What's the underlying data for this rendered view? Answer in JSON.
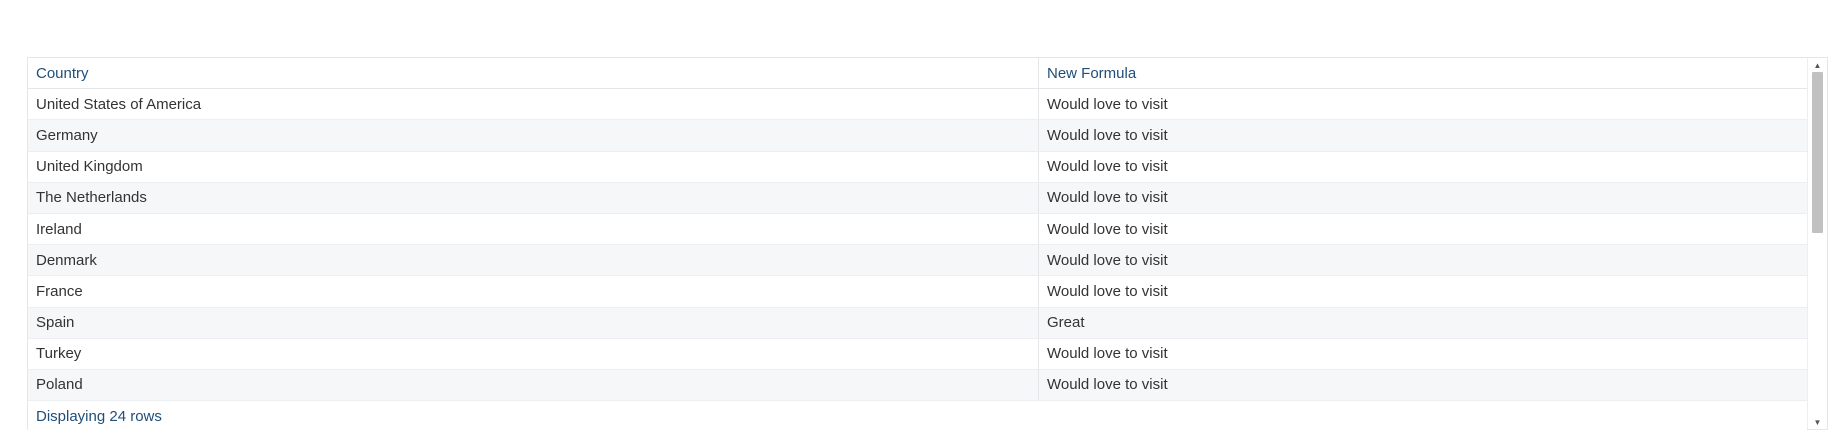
{
  "table": {
    "columns": [
      "Country",
      "New Formula"
    ],
    "rows": [
      [
        "United States of America",
        "Would love to visit"
      ],
      [
        "Germany",
        "Would love to visit"
      ],
      [
        "United Kingdom",
        "Would love to visit"
      ],
      [
        "The Netherlands",
        "Would love to visit"
      ],
      [
        "Ireland",
        "Would love to visit"
      ],
      [
        "Denmark",
        "Would love to visit"
      ],
      [
        "France",
        "Would love to visit"
      ],
      [
        "Spain",
        "Great"
      ],
      [
        "Turkey",
        "Would love to visit"
      ],
      [
        "Poland",
        "Would love to visit"
      ]
    ],
    "footer": "Displaying 24 rows"
  },
  "scrollbar": {
    "up_icon": "triangle-up",
    "down_icon": "triangle-down"
  },
  "colors": {
    "header_text": "#1f4e79",
    "row_alt": "#f6f7f9",
    "border": "#e4e6ea"
  }
}
